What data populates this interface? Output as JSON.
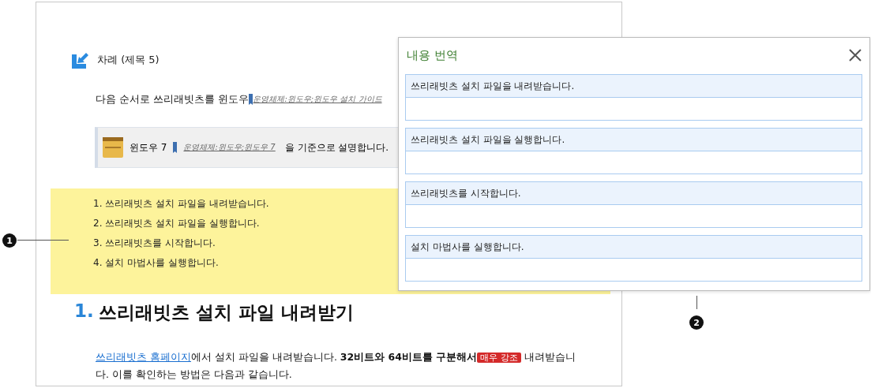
{
  "document": {
    "toc_heading": "차례 (제목 5)",
    "intro": {
      "text": "다음 순서로 쓰리래빗츠를 윈도우",
      "index_tag": "운영체제:윈도우;윈도우 설치 가이드"
    },
    "note": {
      "before": "윈도우 7",
      "index_tag": "운영체제:윈도우;윈도우 7",
      "after": "을 기준으로 설명합니다."
    },
    "steps": [
      "1. 쓰리래빗츠 설치 파일을 내려받습니다.",
      "2. 쓰리래빗츠 설치 파일을 실행합니다.",
      "3. 쓰리래빗츠를 시작합니다.",
      "4. 설치 마법사를 실행합니다."
    ],
    "section_heading": {
      "number": "1.",
      "title": "쓰리래빗츠 설치 파일 내려받기"
    },
    "paragraph": {
      "link": "쓰리래빗츠 홈페이지",
      "text": "에서 설치 파일을 내려받습니다. **32비트와 64비트를 구분해서**",
      "badge": "매우 강조",
      "after": " 내려받습니다. 이를 확인하는 방법은 다음과 같습니다."
    }
  },
  "callouts": [
    {
      "number": "1"
    },
    {
      "number": "2"
    }
  ],
  "translation_panel": {
    "title": "내용 번역",
    "items": [
      {
        "source": "쓰리래빗츠 설치 파일을 내려받습니다."
      },
      {
        "source": "쓰리래빗츠 설치 파일을 실행합니다."
      },
      {
        "source": "쓰리래빗츠를 시작합니다."
      },
      {
        "source": "설치 마법사를 실행합니다."
      }
    ]
  }
}
